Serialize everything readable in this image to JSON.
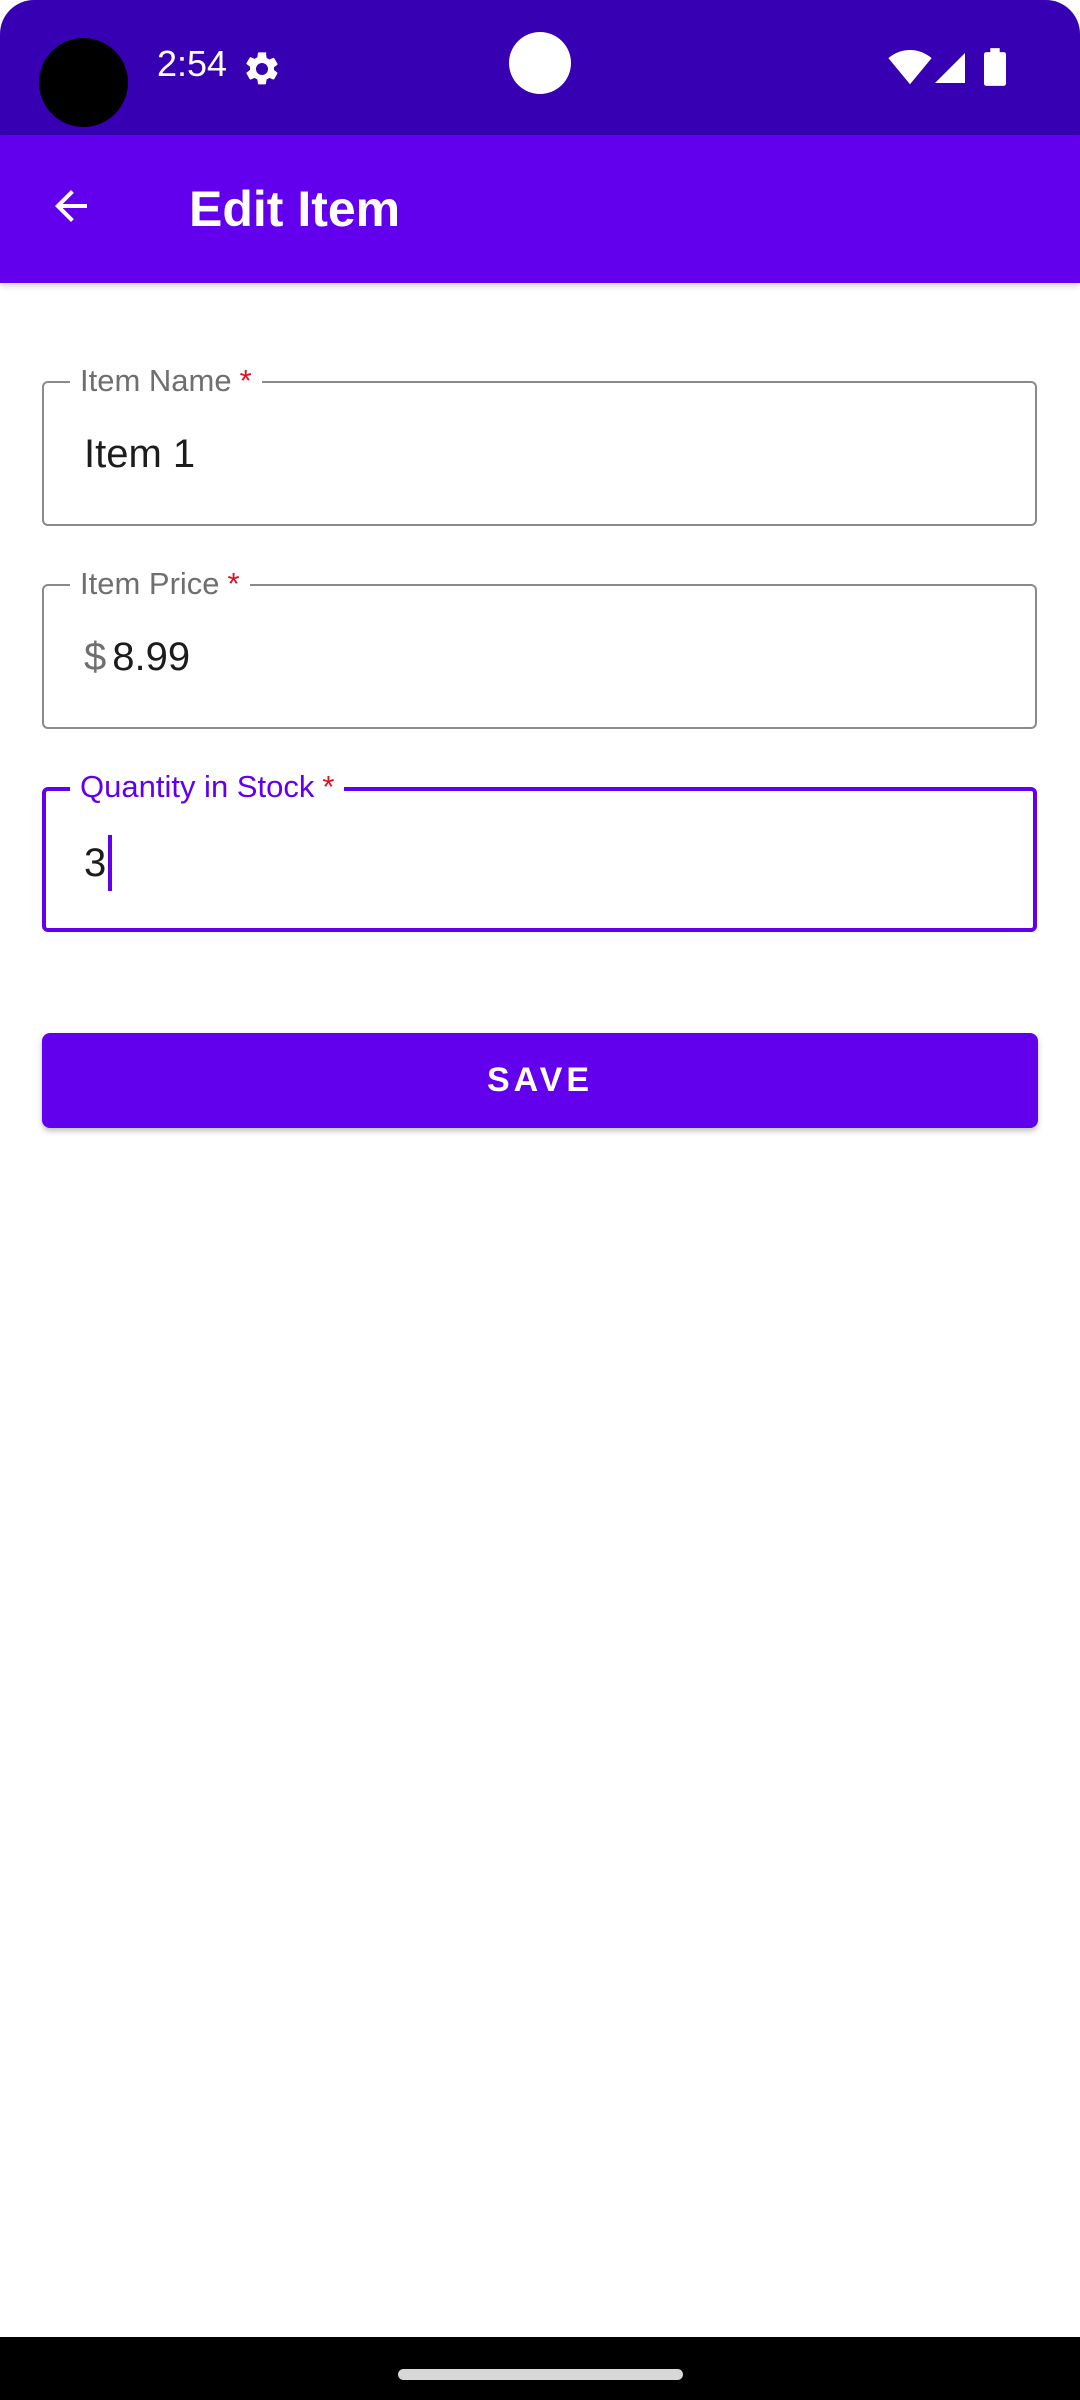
{
  "status_bar": {
    "time": "2:54",
    "colors": {
      "background": "#3700b3",
      "icon": "#ffffff"
    },
    "icons": [
      "gear-icon",
      "wifi-icon",
      "signal-icon",
      "battery-icon"
    ]
  },
  "app_bar": {
    "title": "Edit Item",
    "back_icon": "arrow-left-icon",
    "colors": {
      "background": "#6200ee",
      "text": "#ffffff"
    }
  },
  "form": {
    "item_name": {
      "label": "Item Name",
      "required_mark": "*",
      "value": "Item 1"
    },
    "item_price": {
      "label": "Item Price",
      "required_mark": "*",
      "prefix": "$",
      "value": "8.99"
    },
    "quantity": {
      "label": "Quantity in Stock",
      "required_mark": "*",
      "value": "3",
      "focused": true
    },
    "colors": {
      "focus": "#6200ee",
      "required": "#e0101f",
      "outline": "#8a8a8a"
    }
  },
  "save_button": {
    "label": "SAVE",
    "color": "#6200ee"
  }
}
